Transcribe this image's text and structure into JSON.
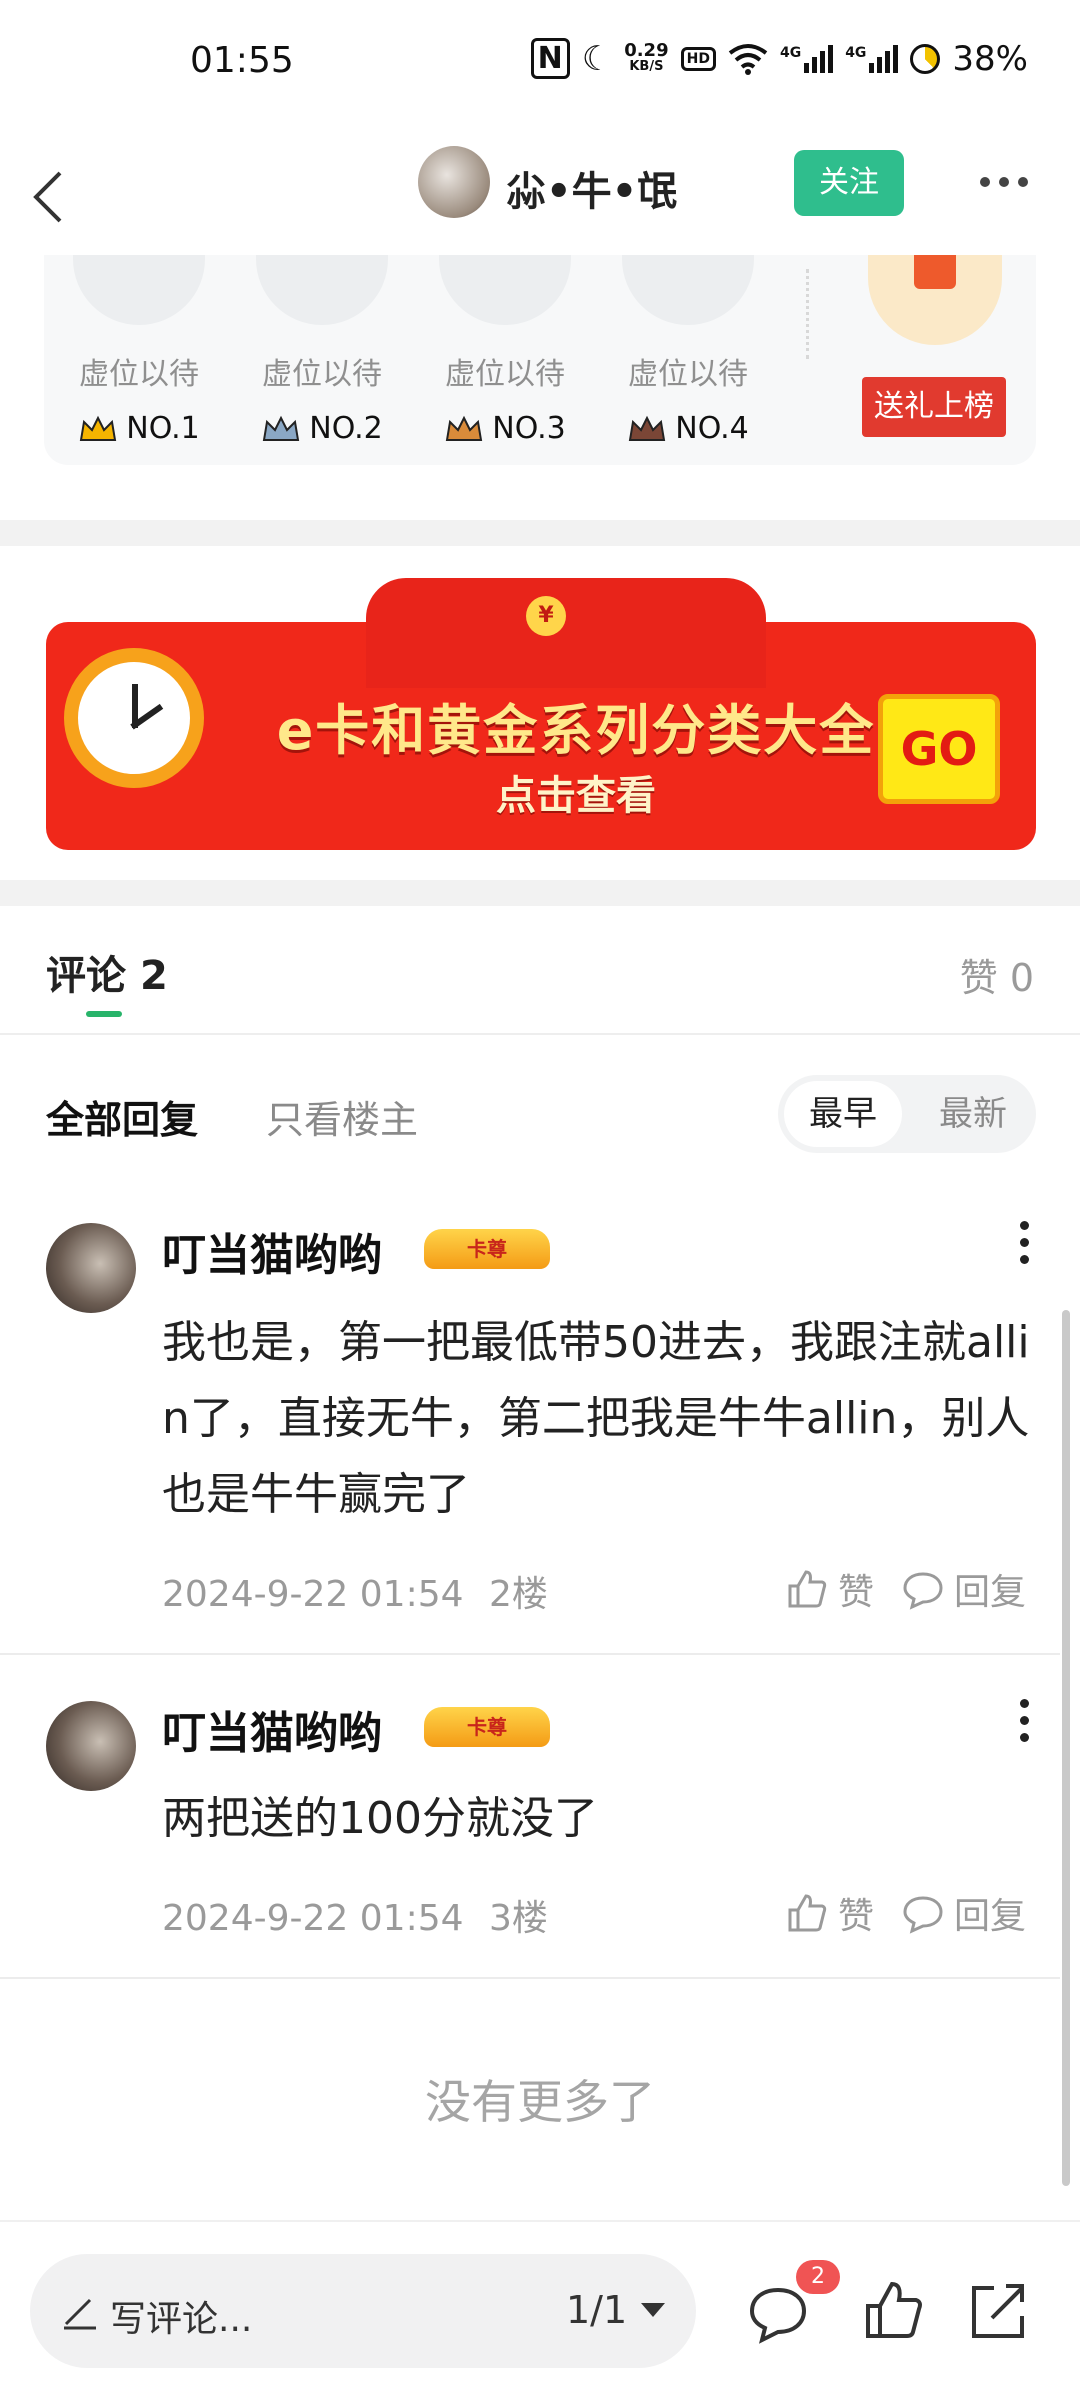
{
  "status_bar": {
    "time": "01:55",
    "net_speed_value": "0.29",
    "net_speed_unit": "KB/S",
    "hd_label": "HD",
    "signal_label_1": "4G",
    "signal_label_2": "4G",
    "battery": "38%"
  },
  "header": {
    "username": "尛•牛•氓",
    "follow_label": "关注"
  },
  "gift_rank": {
    "slots": [
      {
        "wait": "虚位以待",
        "rank": "NO.1",
        "crown_color": "#f5b400"
      },
      {
        "wait": "虚位以待",
        "rank": "NO.2",
        "crown_color": "#8aa7c4"
      },
      {
        "wait": "虚位以待",
        "rank": "NO.3",
        "crown_color": "#d98b3a"
      },
      {
        "wait": "虚位以待",
        "rank": "NO.4",
        "crown_color": "#7a4636"
      }
    ],
    "send_label": "送礼上榜"
  },
  "banner": {
    "title": "e卡和黄金系列分类大全",
    "subtitle": "点击查看",
    "go_label": "GO"
  },
  "comments_header": {
    "title": "评论",
    "count": "2",
    "likes_label": "赞 0"
  },
  "filter": {
    "all_label": "全部回复",
    "owner_only_label": "只看楼主",
    "sort_earliest": "最早",
    "sort_newest": "最新"
  },
  "comments": [
    {
      "name": "叮当猫哟哟",
      "badge": "卡尊",
      "text": "我也是，第一把最低带50进去，我跟注就allin了，直接无牛，第二把我是牛牛allin，别人也是牛牛赢完了",
      "date": "2024-9-22 01:54",
      "floor": "2楼",
      "like_label": "赞",
      "reply_label": "回复"
    },
    {
      "name": "叮当猫哟哟",
      "badge": "卡尊",
      "text": "两把送的100分就没了",
      "date": "2024-9-22 01:54",
      "floor": "3楼",
      "like_label": "赞",
      "reply_label": "回复"
    }
  ],
  "no_more": "没有更多了",
  "bottom_bar": {
    "write_placeholder": "写评论...",
    "page_indicator": "1/1",
    "comment_badge": "2"
  }
}
